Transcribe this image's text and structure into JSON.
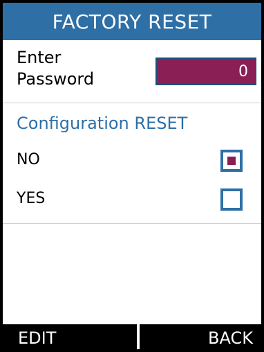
{
  "screen": {
    "title": "FACTORY RESET"
  },
  "password": {
    "label_line1": "Enter",
    "label_line2": "Password",
    "value": "0"
  },
  "configuration": {
    "title": "Configuration RESET",
    "options": [
      {
        "label": "NO",
        "selected": true
      },
      {
        "label": "YES",
        "selected": false
      }
    ]
  },
  "softkeys": {
    "left": "EDIT",
    "right": "BACK"
  },
  "colors": {
    "accent_blue": "#2e6fa6",
    "field_magenta": "#8a1f56",
    "softkey_bar": "#000000"
  },
  "icons": {
    "selected_option": "checkbox-checked-icon",
    "unselected_option": "checkbox-empty-icon"
  }
}
